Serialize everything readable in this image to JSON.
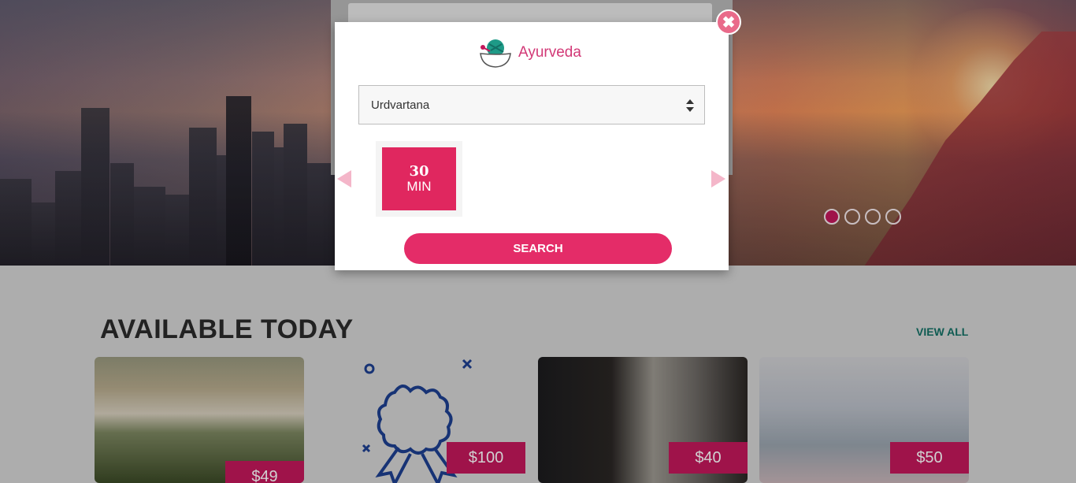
{
  "hero": {
    "carousel_dots": 4,
    "active_dot": 0,
    "background_search_text": "Ayurveda"
  },
  "modal": {
    "brand_name": "Ayurveda",
    "brand_icon": "mortar-pestle-icon",
    "treatment_select": {
      "selected": "Urdvartana"
    },
    "duration_slot": {
      "number": "30",
      "unit": "MIN"
    },
    "search_label": "SEARCH",
    "close_icon": "close-icon"
  },
  "section": {
    "title": "AVAILABLE TODAY",
    "view_all": "VIEW ALL"
  },
  "cards": [
    {
      "price": "$49",
      "image": "waterfall"
    },
    {
      "price": "$100",
      "image": "award-ribbon-icon"
    },
    {
      "price": "$40",
      "image": "books-statue"
    },
    {
      "price": "$50",
      "image": "seniors-yoga"
    }
  ],
  "colors": {
    "accent": "#e42c68",
    "price_bg": "#c2185b",
    "view_all": "#137065"
  }
}
